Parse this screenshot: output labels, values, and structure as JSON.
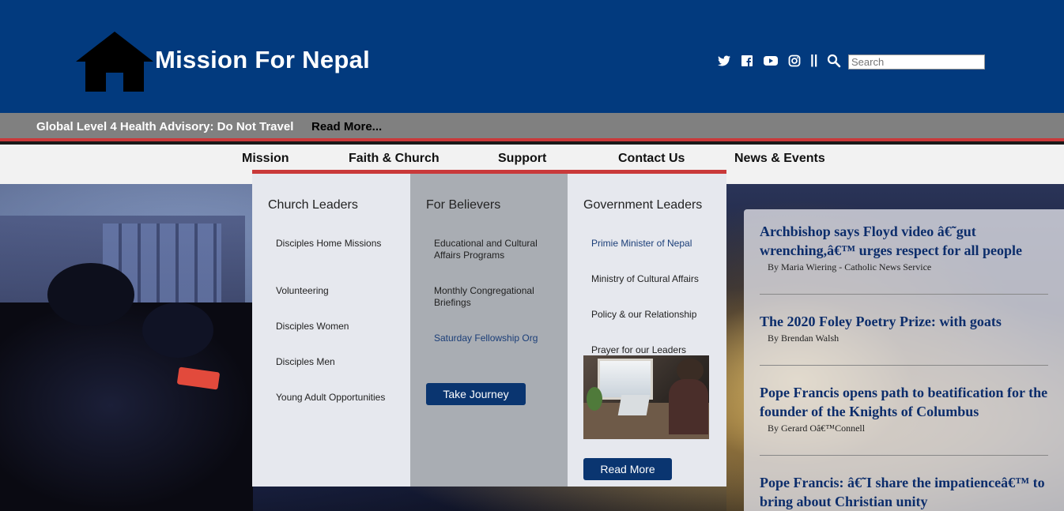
{
  "header": {
    "site_title": "Mission For Nepal",
    "search_placeholder": "Search",
    "divider": "||",
    "brand_color": "#023a7e",
    "accent_color": "#c9393a"
  },
  "advisory": {
    "text": "Global Level 4 Health Advisory: Do Not Travel",
    "link": "Read More..."
  },
  "nav": {
    "items": [
      "Mission",
      "Faith & Church",
      "Support",
      "Contact Us",
      "News & Events"
    ]
  },
  "mega_menu": {
    "columns": [
      {
        "title": "Church Leaders",
        "links": [
          "Disciples Home Missions",
          "Volunteering",
          "Disciples Women",
          "Disciples Men",
          "Young Adult Opportunities"
        ]
      },
      {
        "title": "For Believers",
        "links": [
          "Educational and Cultural Affairs Programs",
          "Monthly Congregational Briefings",
          "Saturday Fellowship Org"
        ],
        "button": "Take Journey"
      },
      {
        "title": "Government Leaders",
        "links": [
          "Primie Minister of Nepal",
          "Ministry of Cultural Affairs",
          "Policy & our Relationship",
          "Prayer for our Leaders"
        ],
        "button": "Read More"
      }
    ]
  },
  "news": [
    {
      "title": "Archbishop says Floyd video â€˜gut wrenching,â€™ urges respect for all people",
      "byline": "By Maria Wiering - Catholic News Service"
    },
    {
      "title": "The 2020 Foley Poetry Prize: with goats",
      "byline": "By Brendan Walsh"
    },
    {
      "title": "Pope Francis opens path to beatification for the founder of the Knights of Columbus",
      "byline": "By Gerard Oâ€™Connell"
    },
    {
      "title": "Pope Francis: â€˜I share the impatienceâ€™ to bring about Christian unity",
      "byline": ""
    }
  ],
  "icons": [
    "home-icon",
    "twitter-icon",
    "facebook-icon",
    "youtube-icon",
    "instagram-icon",
    "search-icon"
  ]
}
